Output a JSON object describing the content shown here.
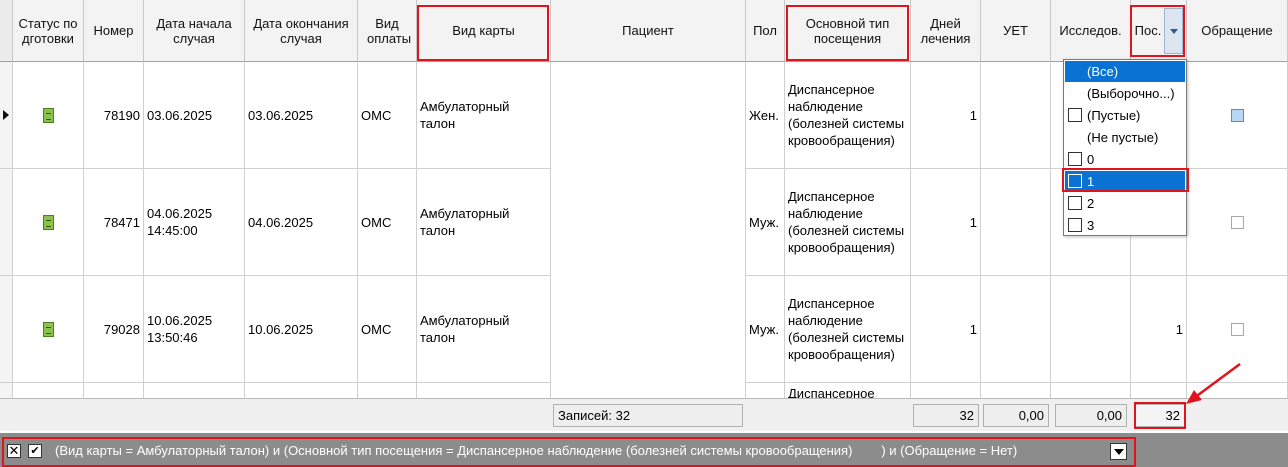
{
  "columns": [
    {
      "id": "status",
      "label": "Статус подготовки"
    },
    {
      "id": "number",
      "label": "Номер"
    },
    {
      "id": "start_date",
      "label": "Дата начала случая"
    },
    {
      "id": "end_date",
      "label": "Дата окончания случая"
    },
    {
      "id": "payment",
      "label": "Вид оплаты"
    },
    {
      "id": "card_type",
      "label": "Вид карты"
    },
    {
      "id": "patient",
      "label": "Пациент"
    },
    {
      "id": "sex",
      "label": "Пол"
    },
    {
      "id": "visit_type",
      "label": "Основной тип посещения"
    },
    {
      "id": "days",
      "label": "Дней лечения"
    },
    {
      "id": "uet",
      "label": "УЕТ"
    },
    {
      "id": "research",
      "label": "Исследов."
    },
    {
      "id": "pos",
      "label": "Пос."
    },
    {
      "id": "appeal",
      "label": "Обращение"
    }
  ],
  "rows": [
    {
      "number": "78190",
      "start_date": "03.06.2025",
      "end_date": "03.06.2025",
      "payment": "ОМС",
      "card_type": "Амбулаторный талон",
      "patient": "",
      "sex": "Жен.",
      "visit_type": "Диспансерное наблюдение (болезней системы кровообращения)",
      "days": "1",
      "uet": "",
      "research": "",
      "pos": "",
      "appeal_checked": true,
      "current": true
    },
    {
      "number": "78471",
      "start_date": "04.06.2025 14:45:00",
      "end_date": "04.06.2025",
      "payment": "ОМС",
      "card_type": "Амбулаторный талон",
      "patient": "",
      "sex": "Муж.",
      "visit_type": "Диспансерное наблюдение (болезней системы кровообращения)",
      "days": "1",
      "uet": "",
      "research": "",
      "pos": "",
      "appeal_checked": false,
      "current": false
    },
    {
      "number": "79028",
      "start_date": "10.06.2025 13:50:46",
      "end_date": "10.06.2025",
      "payment": "ОМС",
      "card_type": "Амбулаторный талон",
      "patient": "",
      "sex": "Муж.",
      "visit_type": "Диспансерное наблюдение (болезней системы кровообращения)",
      "days": "1",
      "uet": "",
      "research": "",
      "pos": "1",
      "appeal_checked": false,
      "current": false
    },
    {
      "number": "",
      "start_date": "",
      "end_date": "",
      "payment": "",
      "card_type": "",
      "patient": "",
      "sex": "",
      "visit_type": "Диспансерное",
      "days": "",
      "uet": "",
      "research": "",
      "pos": "",
      "appeal_checked": false,
      "current": false
    }
  ],
  "filter_dropdown": {
    "options": [
      {
        "label": "(Все)",
        "checkbox": false,
        "selected": true
      },
      {
        "label": "(Выборочно...)",
        "checkbox": false,
        "selected": false
      },
      {
        "label": "(Пустые)",
        "checkbox": true,
        "selected": false
      },
      {
        "label": "(Не пустые)",
        "checkbox": false,
        "selected": false
      },
      {
        "label": "0",
        "checkbox": true,
        "selected": false
      },
      {
        "label": "1",
        "checkbox": true,
        "selected": true
      },
      {
        "label": "2",
        "checkbox": true,
        "selected": false
      },
      {
        "label": "3",
        "checkbox": true,
        "selected": false
      }
    ]
  },
  "footer": {
    "records": "Записей: 32",
    "days_total": "32",
    "uet_total": "0,00",
    "research_total": "0,00",
    "pos_total": "32"
  },
  "filter_bar": {
    "text": "(Вид карты = Амбулаторный талон) и (Основной тип посещения = Диспансерное наблюдение (болезней системы кровообращения)        ) и (Обращение = Нет)"
  },
  "colors": {
    "highlight": "#e0141e",
    "selection": "#0a72d2",
    "filter_bar_bg": "#8c8c8c"
  }
}
